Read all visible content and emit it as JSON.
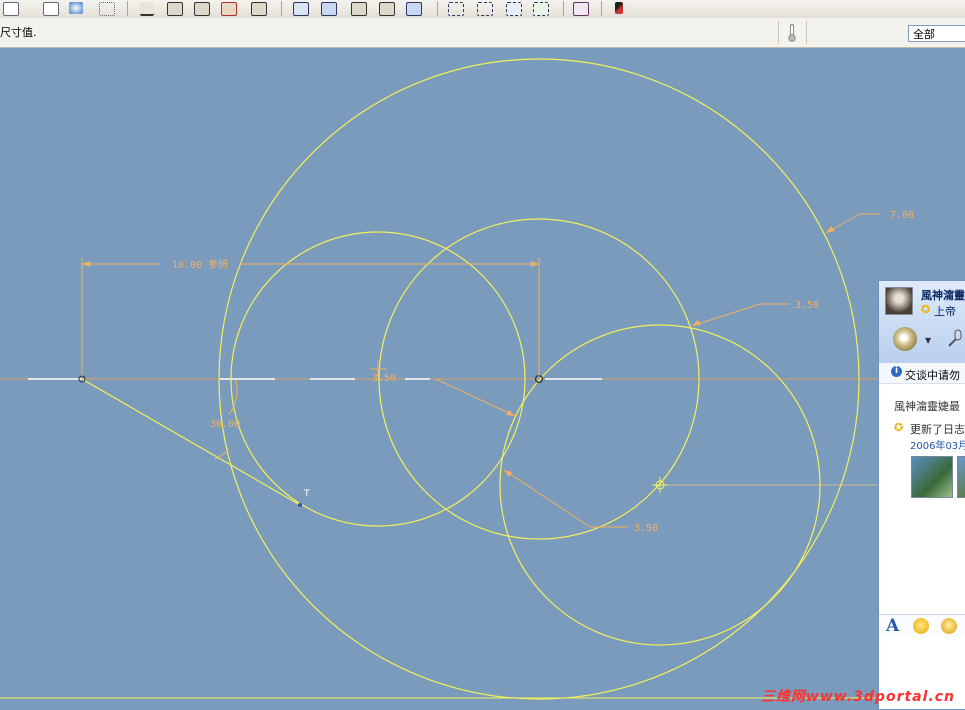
{
  "message_bar": {
    "text": "尺寸值.",
    "filter_value": "全部"
  },
  "sketch": {
    "dimensions": {
      "horizontal": "10.00 参照",
      "angle": "30.00",
      "dia_large": "7.00",
      "dia_middle": "3.50",
      "center_label": "3.50",
      "dia_small": "3.50"
    },
    "tangent_mark": "T",
    "colors": {
      "background": "#7b9bbd",
      "geometry": "#f2f05a",
      "dimension": "#f0b060"
    }
  },
  "chat": {
    "name": "風神澝靈",
    "status": "上帝",
    "notice": "交谈中请勿",
    "line1": "風神澝靈婕最",
    "line2": "更新了日志",
    "line3": "2006年03月"
  },
  "watermark": "三维网www.3dportal.cn"
}
